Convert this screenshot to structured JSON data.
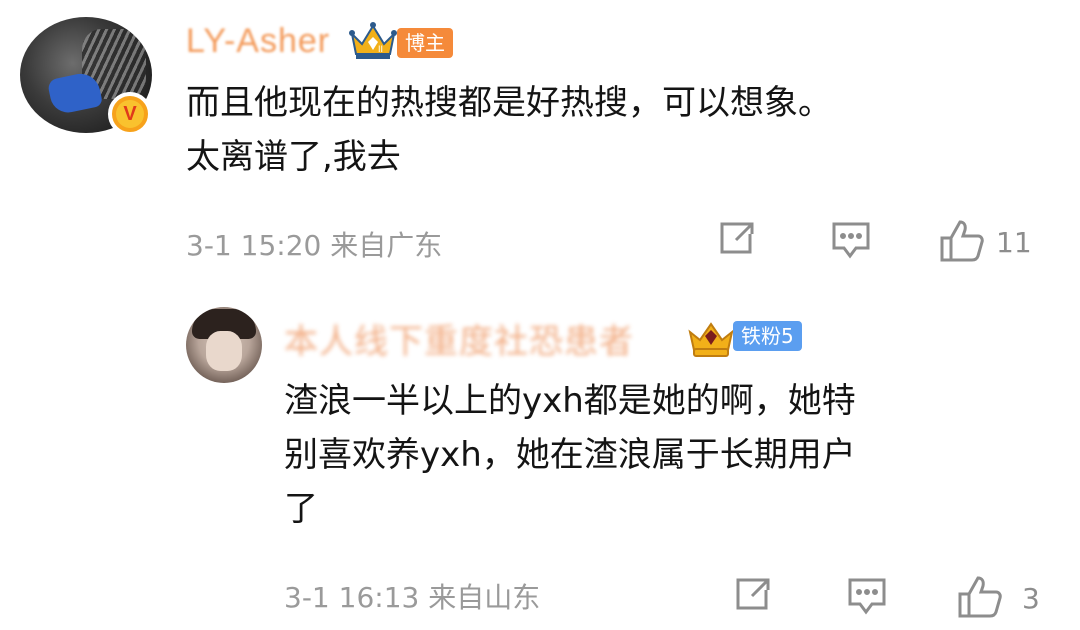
{
  "comments": [
    {
      "username": "LY-Asher",
      "badge_label": "博主",
      "text_line1": "而且他现在的热搜都是好热搜，可以想象。",
      "text_line2": "太离谱了,我去",
      "time": "3-1 15:20",
      "location": "来自广东",
      "likes": "11",
      "verified_mark": "V",
      "icons": [
        "avatar",
        "verified-badge-icon",
        "crown-icon",
        "share-icon",
        "comment-icon",
        "like-icon"
      ]
    },
    {
      "username": "本人线下重度社恐患者",
      "badge_label": "铁粉5",
      "text_line1": "渣浪一半以上的yxh都是她的啊，她特",
      "text_line2": "别喜欢养yxh，她在渣浪属于长期用户",
      "text_line3": "了",
      "time": "3-1 16:13",
      "location": "来自山东",
      "likes": "3",
      "icons": [
        "avatar",
        "crown-icon",
        "share-icon",
        "comment-icon",
        "like-icon"
      ]
    }
  ],
  "colors": {
    "blogger_tag": "#f58a3a",
    "fan_tag": "#5b9ef0",
    "meta_text": "#9a9a9a",
    "body_text": "#141414"
  }
}
